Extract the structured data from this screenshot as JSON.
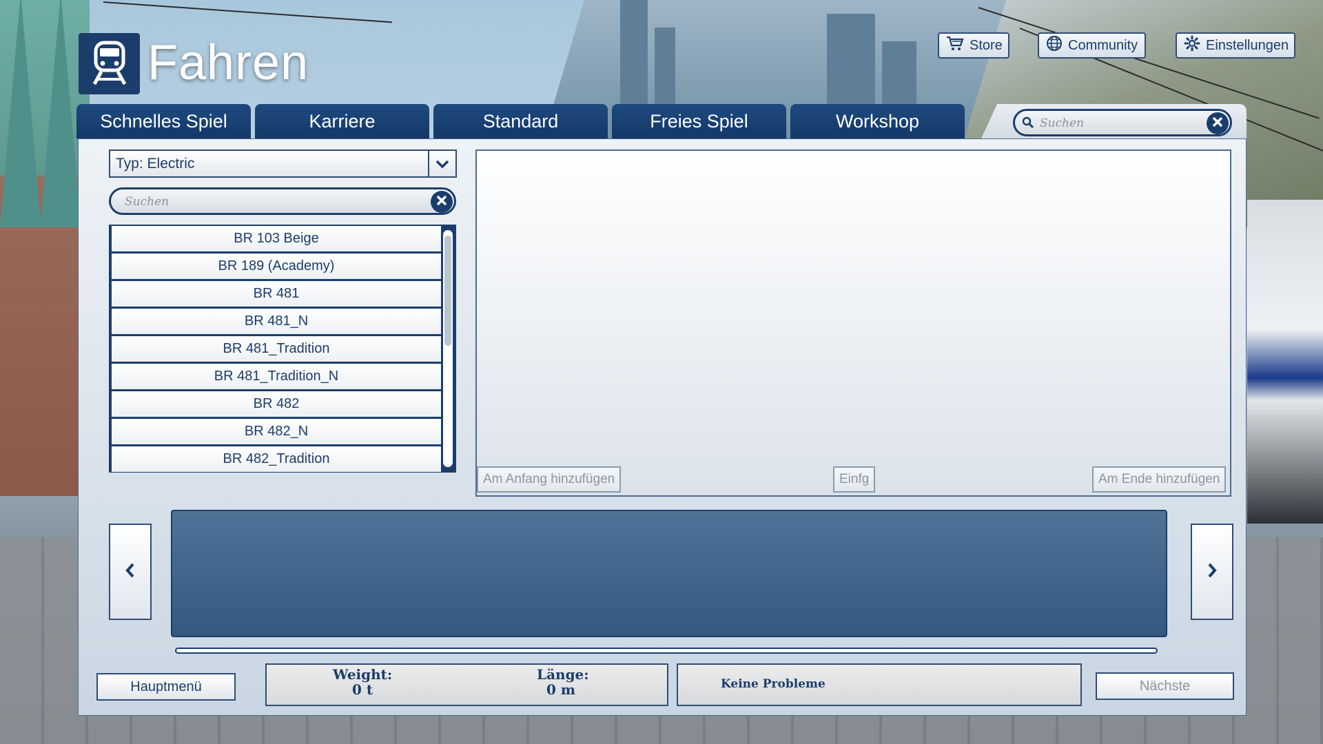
{
  "header": {
    "title": "Fahren",
    "logo_icon": "train-icon",
    "buttons": [
      {
        "label": "Store",
        "icon": "cart-icon"
      },
      {
        "label": "Community",
        "icon": "globe-icon"
      },
      {
        "label": "Einstellungen",
        "icon": "gear-icon"
      }
    ]
  },
  "tabs": [
    {
      "label": "Schnelles Spiel"
    },
    {
      "label": "Karriere"
    },
    {
      "label": "Standard"
    },
    {
      "label": "Freies Spiel"
    },
    {
      "label": "Workshop"
    }
  ],
  "top_search": {
    "placeholder": "Suchen"
  },
  "filter": {
    "type_select": "Typ: Electric",
    "search_placeholder": "Suchen"
  },
  "vehicle_list": {
    "items": [
      "BR 103 Beige",
      "BR 189 (Academy)",
      "BR 481",
      "BR 481_N",
      "BR 481_Tradition",
      "BR 481_Tradition_N",
      "BR 482",
      "BR 482_N",
      "BR 482_Tradition"
    ]
  },
  "preview": {
    "add_start": "Am Anfang hinzufügen",
    "insert": "Einfg",
    "add_end": "Am Ende hinzufügen"
  },
  "footer": {
    "main_menu": "Hauptmenü",
    "weight_label": "Weight:",
    "weight_value": "0 t",
    "length_label": "Länge:",
    "length_value": "0 m",
    "status": "Keine Probleme",
    "next": "Nächste"
  },
  "colors": {
    "primary": "#1b3d6b",
    "tab": "#1e4a7f",
    "disabled_text": "#8c96a0"
  }
}
